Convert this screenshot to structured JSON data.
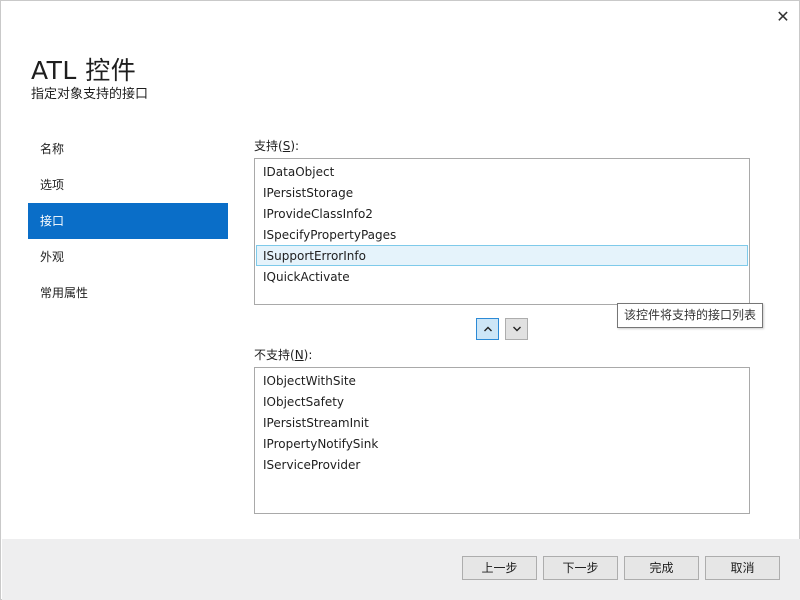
{
  "window": {
    "title": "ATL 控件",
    "subtitle": "指定对象支持的接口",
    "close_glyph": "✕"
  },
  "nav": {
    "items": [
      {
        "label": "名称"
      },
      {
        "label": "选项"
      },
      {
        "label": "接口",
        "selected": true
      },
      {
        "label": "外观"
      },
      {
        "label": "常用属性"
      }
    ]
  },
  "supported": {
    "label_pre": "支持(",
    "label_key": "S",
    "label_post": "):",
    "items": [
      {
        "label": "IDataObject"
      },
      {
        "label": "IPersistStorage"
      },
      {
        "label": "IProvideClassInfo2"
      },
      {
        "label": "ISpecifyPropertyPages"
      },
      {
        "label": "ISupportErrorInfo",
        "selected": true
      },
      {
        "label": "IQuickActivate"
      }
    ]
  },
  "move_buttons": {
    "up_icon": "chevron-up-icon",
    "down_icon": "chevron-down-icon"
  },
  "tooltip": {
    "text": "该控件将支持的接口列表"
  },
  "unsupported": {
    "label_pre": "不支持(",
    "label_key": "N",
    "label_post": "):",
    "items": [
      {
        "label": "IObjectWithSite"
      },
      {
        "label": "IObjectSafety"
      },
      {
        "label": "IPersistStreamInit"
      },
      {
        "label": "IPropertyNotifySink"
      },
      {
        "label": "IServiceProvider"
      }
    ]
  },
  "footer": {
    "prev_label": "上一步",
    "next_label": "下一步",
    "finish_label": "完成",
    "cancel_label": "取消"
  },
  "colors": {
    "accent": "#0a6ec8",
    "selection_bg": "#e5f3fb",
    "selection_border": "#7ecaea"
  }
}
